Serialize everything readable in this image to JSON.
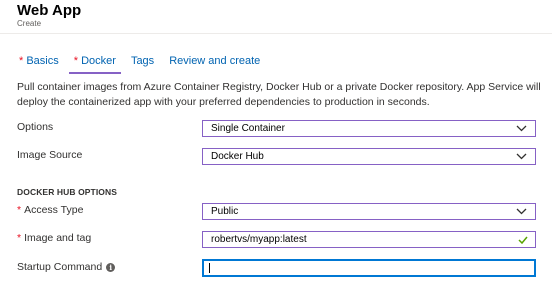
{
  "header": {
    "title": "Web App",
    "subtitle": "Create"
  },
  "tabs": [
    {
      "label": "Basics",
      "required": true,
      "active": false
    },
    {
      "label": "Docker",
      "required": true,
      "active": true
    },
    {
      "label": "Tags",
      "required": false,
      "active": false
    },
    {
      "label": "Review and create",
      "required": false,
      "active": false
    }
  ],
  "tab_required_marker": "*",
  "description": "Pull container images from Azure Container Registry, Docker Hub or a private Docker repository. App Service will deploy the containerized app with your preferred dependencies to production in seconds.",
  "form": {
    "options": {
      "label": "Options",
      "value": "Single Container"
    },
    "image_source": {
      "label": "Image Source",
      "value": "Docker Hub"
    },
    "section_title": "DOCKER HUB OPTIONS",
    "access_type": {
      "label": "Access Type",
      "value": "Public",
      "required_marker": "*"
    },
    "image_tag": {
      "label": "Image and tag",
      "value": "robertvs/myapp:latest",
      "required_marker": "*"
    },
    "startup_command": {
      "label": "Startup Command",
      "value": "",
      "info_icon": "i"
    }
  },
  "colors": {
    "tab_link": "#0063b1",
    "active_tab_underline": "#8661c5",
    "required_star": "#e81123",
    "field_border": "#8661c5",
    "focus_border": "#0078d4",
    "valid_check": "#57a300"
  },
  "icons": {
    "dropdown": "chevron-down-icon",
    "valid": "checkmark-icon",
    "info": "info-icon"
  }
}
